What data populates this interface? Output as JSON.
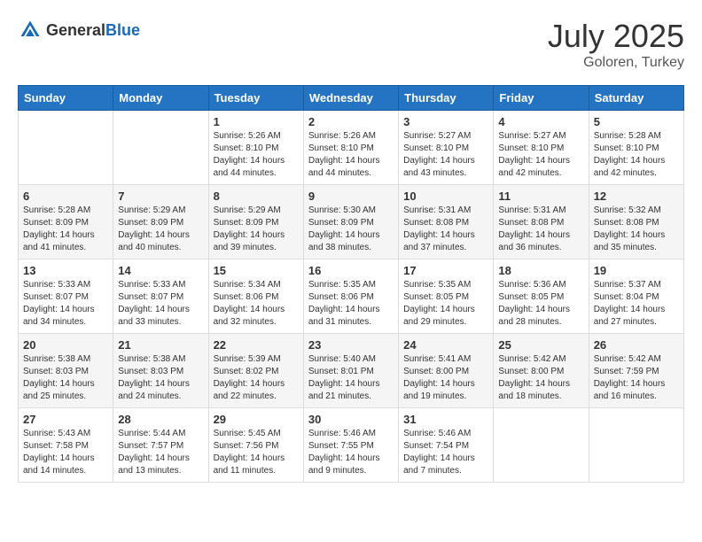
{
  "header": {
    "logo_general": "General",
    "logo_blue": "Blue",
    "month_title": "July 2025",
    "location": "Goloren, Turkey"
  },
  "weekdays": [
    "Sunday",
    "Monday",
    "Tuesday",
    "Wednesday",
    "Thursday",
    "Friday",
    "Saturday"
  ],
  "weeks": [
    [
      {
        "day": "",
        "info": ""
      },
      {
        "day": "",
        "info": ""
      },
      {
        "day": "1",
        "info": "Sunrise: 5:26 AM\nSunset: 8:10 PM\nDaylight: 14 hours and 44 minutes."
      },
      {
        "day": "2",
        "info": "Sunrise: 5:26 AM\nSunset: 8:10 PM\nDaylight: 14 hours and 44 minutes."
      },
      {
        "day": "3",
        "info": "Sunrise: 5:27 AM\nSunset: 8:10 PM\nDaylight: 14 hours and 43 minutes."
      },
      {
        "day": "4",
        "info": "Sunrise: 5:27 AM\nSunset: 8:10 PM\nDaylight: 14 hours and 42 minutes."
      },
      {
        "day": "5",
        "info": "Sunrise: 5:28 AM\nSunset: 8:10 PM\nDaylight: 14 hours and 42 minutes."
      }
    ],
    [
      {
        "day": "6",
        "info": "Sunrise: 5:28 AM\nSunset: 8:09 PM\nDaylight: 14 hours and 41 minutes."
      },
      {
        "day": "7",
        "info": "Sunrise: 5:29 AM\nSunset: 8:09 PM\nDaylight: 14 hours and 40 minutes."
      },
      {
        "day": "8",
        "info": "Sunrise: 5:29 AM\nSunset: 8:09 PM\nDaylight: 14 hours and 39 minutes."
      },
      {
        "day": "9",
        "info": "Sunrise: 5:30 AM\nSunset: 8:09 PM\nDaylight: 14 hours and 38 minutes."
      },
      {
        "day": "10",
        "info": "Sunrise: 5:31 AM\nSunset: 8:08 PM\nDaylight: 14 hours and 37 minutes."
      },
      {
        "day": "11",
        "info": "Sunrise: 5:31 AM\nSunset: 8:08 PM\nDaylight: 14 hours and 36 minutes."
      },
      {
        "day": "12",
        "info": "Sunrise: 5:32 AM\nSunset: 8:08 PM\nDaylight: 14 hours and 35 minutes."
      }
    ],
    [
      {
        "day": "13",
        "info": "Sunrise: 5:33 AM\nSunset: 8:07 PM\nDaylight: 14 hours and 34 minutes."
      },
      {
        "day": "14",
        "info": "Sunrise: 5:33 AM\nSunset: 8:07 PM\nDaylight: 14 hours and 33 minutes."
      },
      {
        "day": "15",
        "info": "Sunrise: 5:34 AM\nSunset: 8:06 PM\nDaylight: 14 hours and 32 minutes."
      },
      {
        "day": "16",
        "info": "Sunrise: 5:35 AM\nSunset: 8:06 PM\nDaylight: 14 hours and 31 minutes."
      },
      {
        "day": "17",
        "info": "Sunrise: 5:35 AM\nSunset: 8:05 PM\nDaylight: 14 hours and 29 minutes."
      },
      {
        "day": "18",
        "info": "Sunrise: 5:36 AM\nSunset: 8:05 PM\nDaylight: 14 hours and 28 minutes."
      },
      {
        "day": "19",
        "info": "Sunrise: 5:37 AM\nSunset: 8:04 PM\nDaylight: 14 hours and 27 minutes."
      }
    ],
    [
      {
        "day": "20",
        "info": "Sunrise: 5:38 AM\nSunset: 8:03 PM\nDaylight: 14 hours and 25 minutes."
      },
      {
        "day": "21",
        "info": "Sunrise: 5:38 AM\nSunset: 8:03 PM\nDaylight: 14 hours and 24 minutes."
      },
      {
        "day": "22",
        "info": "Sunrise: 5:39 AM\nSunset: 8:02 PM\nDaylight: 14 hours and 22 minutes."
      },
      {
        "day": "23",
        "info": "Sunrise: 5:40 AM\nSunset: 8:01 PM\nDaylight: 14 hours and 21 minutes."
      },
      {
        "day": "24",
        "info": "Sunrise: 5:41 AM\nSunset: 8:00 PM\nDaylight: 14 hours and 19 minutes."
      },
      {
        "day": "25",
        "info": "Sunrise: 5:42 AM\nSunset: 8:00 PM\nDaylight: 14 hours and 18 minutes."
      },
      {
        "day": "26",
        "info": "Sunrise: 5:42 AM\nSunset: 7:59 PM\nDaylight: 14 hours and 16 minutes."
      }
    ],
    [
      {
        "day": "27",
        "info": "Sunrise: 5:43 AM\nSunset: 7:58 PM\nDaylight: 14 hours and 14 minutes."
      },
      {
        "day": "28",
        "info": "Sunrise: 5:44 AM\nSunset: 7:57 PM\nDaylight: 14 hours and 13 minutes."
      },
      {
        "day": "29",
        "info": "Sunrise: 5:45 AM\nSunset: 7:56 PM\nDaylight: 14 hours and 11 minutes."
      },
      {
        "day": "30",
        "info": "Sunrise: 5:46 AM\nSunset: 7:55 PM\nDaylight: 14 hours and 9 minutes."
      },
      {
        "day": "31",
        "info": "Sunrise: 5:46 AM\nSunset: 7:54 PM\nDaylight: 14 hours and 7 minutes."
      },
      {
        "day": "",
        "info": ""
      },
      {
        "day": "",
        "info": ""
      }
    ]
  ]
}
